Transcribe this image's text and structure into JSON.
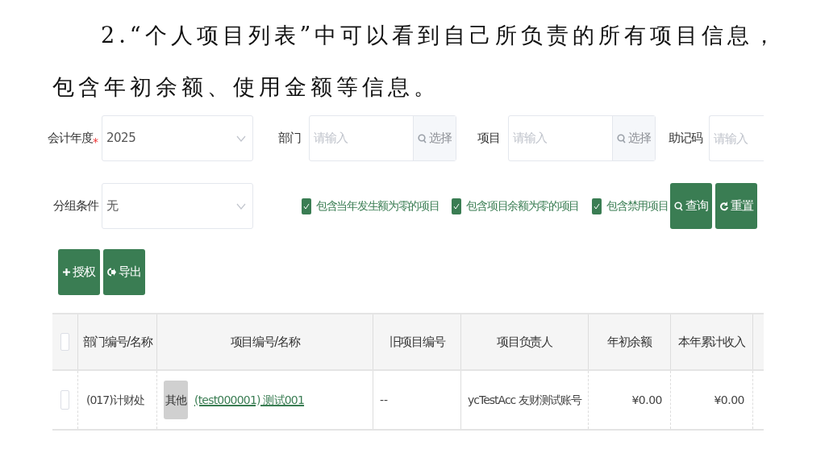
{
  "paragraph": "2.“个人项目列表”中可以看到自己所负责的所有项目信息，包含年初余额、使用金额等信息。",
  "filters": [
    {
      "kind": "select",
      "label": "会计年度",
      "required_mark": "*",
      "value": "2025"
    },
    {
      "kind": "picker",
      "label": "部门",
      "placeholder": "请输入",
      "button": "选择"
    },
    {
      "kind": "picker",
      "label": "项目",
      "placeholder": "请输入",
      "button": "选择"
    },
    {
      "kind": "text",
      "label": "助记码",
      "placeholder": "请输入"
    }
  ],
  "group": {
    "label": "分组条件",
    "value": "无"
  },
  "options": [
    {
      "label": "包含当年发生额为零的项目",
      "checked": true
    },
    {
      "label": "包含项目余额为零的项目",
      "checked": true
    },
    {
      "label": "包含禁用项目",
      "checked": true
    }
  ],
  "search_buttons": [
    {
      "kind": "search",
      "label": "查询"
    },
    {
      "kind": "reset",
      "label": "重置"
    }
  ],
  "actions": [
    {
      "kind": "add",
      "label": "授权"
    },
    {
      "kind": "export",
      "label": "导出"
    }
  ],
  "table": {
    "select_all": {
      "checked": false
    },
    "columns": [
      "部门编号/名称",
      "项目编号/名称",
      "旧项目编号",
      "项目负责人",
      "年初余额",
      "本年累计收入"
    ],
    "rows": [
      {
        "selected": false,
        "dept": "(017)计财处",
        "tag": "其他",
        "project": "(test000001) 测试001",
        "old_code": "--",
        "owner": "ycTestAcc 友财测试账号",
        "opening_balance": "¥0.00",
        "income": "¥0.00"
      }
    ]
  }
}
